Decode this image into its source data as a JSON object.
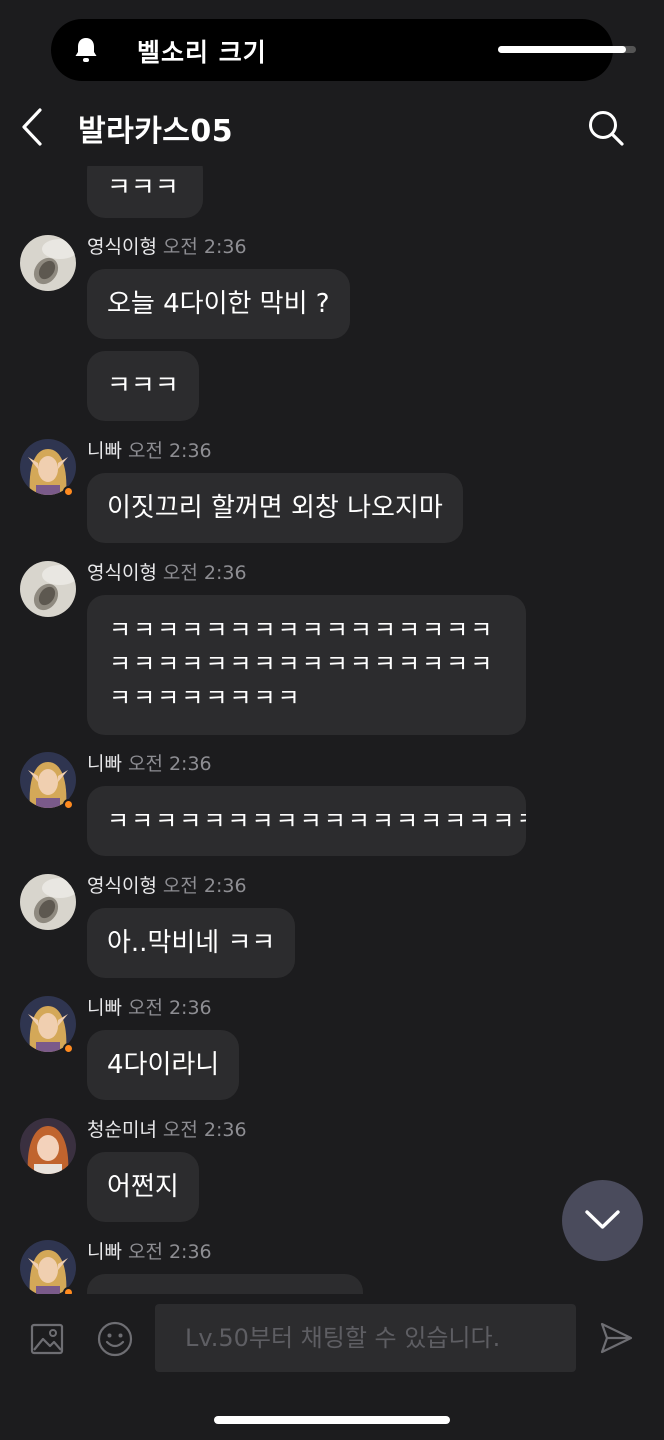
{
  "system": {
    "volume_label": "벨소리 크기",
    "volume_level": 0.93
  },
  "header": {
    "title": "발라카스05"
  },
  "messages": [
    {
      "bubbles": [
        "ㅋㅋㅋ"
      ]
    },
    {
      "name": "영식이형",
      "time": "오전 2:36",
      "bubbles": [
        "오늘  4다이한 막비 ?",
        "ㅋㅋㅋ"
      ]
    },
    {
      "name": "니빠",
      "time": "오전 2:36",
      "bubbles": [
        "이짓끄리 할꺼면 외창 나오지마"
      ]
    },
    {
      "name": "영식이형",
      "time": "오전 2:36",
      "bubbles": [
        "ㅋㅋㅋㅋㅋㅋㅋㅋㅋㅋㅋㅋㅋㅋㅋㅋㅋㅋㅋㅋㅋㅋㅋㅋㅋㅋㅋㅋㅋㅋㅋㅋㅋㅋㅋㅋㅋㅋㅋㅋ"
      ]
    },
    {
      "name": "니빠",
      "time": "오전 2:36",
      "bubbles": [
        "ㅋㅋㅋㅋㅋㅋㅋㅋㅋㅋㅋㅋㅋㅋㅋㅋㅋㅋㅋㅋㅋㅋㅋ"
      ]
    },
    {
      "name": "영식이형",
      "time": "오전 2:36",
      "bubbles": [
        "아..막비네 ㅋㅋ"
      ]
    },
    {
      "name": "니빠",
      "time": "오전 2:36",
      "bubbles": [
        "4다이라니"
      ]
    },
    {
      "name": "청순미녀",
      "time": "오전 2:36",
      "bubbles": [
        "어쩐지"
      ]
    },
    {
      "name": "니빠",
      "time": "오전 2:36",
      "bubbles": [
        ""
      ]
    }
  ],
  "input": {
    "placeholder": "Lv.50부터 채팅할 수 있습니다."
  },
  "colors": {
    "background": "#1c1c1e",
    "bubble": "#2c2c2e",
    "online_dot": "#ff8a1f",
    "fab": "#4a4b5c"
  },
  "icons": [
    "bell-icon",
    "back-arrow-icon",
    "search-icon",
    "chevron-down-icon",
    "image-icon",
    "emoji-icon",
    "send-icon"
  ]
}
